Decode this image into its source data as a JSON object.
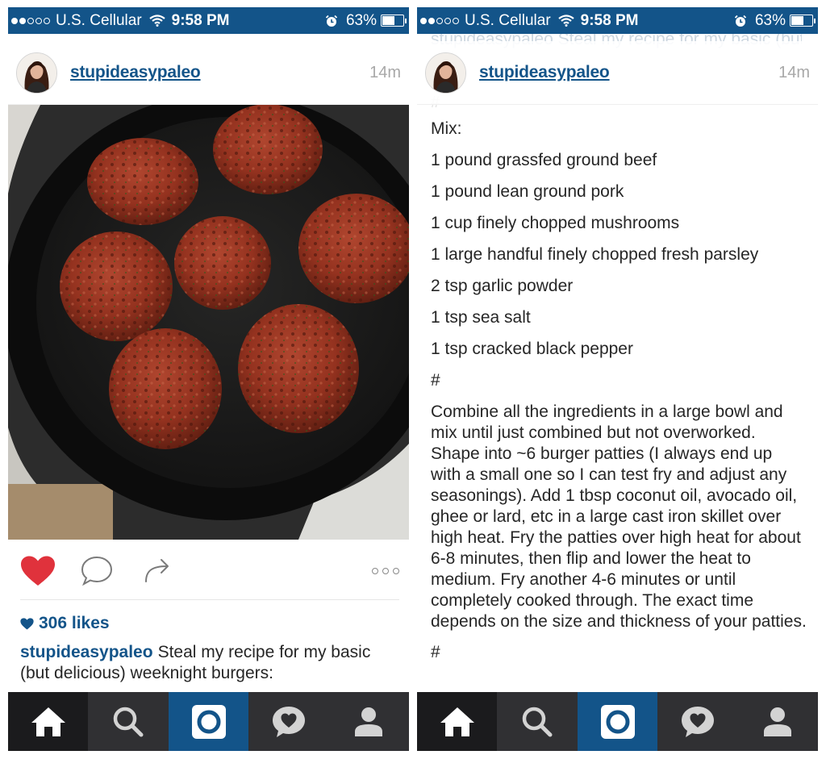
{
  "status_bar": {
    "carrier": "U.S. Cellular",
    "time": "9:58 PM",
    "battery": "63%",
    "battery_level": 0.63
  },
  "post": {
    "username": "stupideasypaleo",
    "age": "14m",
    "likes": "306 likes",
    "caption": "Steal my recipe for my basic (but delicious) weeknight burgers:"
  },
  "recipe_screen": {
    "ghost_caption": "stupideasypaleo Steal my recipe for my basic (but delicious) weeknight burgers:",
    "ghost_hash": "#",
    "mix_heading": "Mix:",
    "ingredients": [
      "1 pound grassfed ground beef",
      "1 pound lean ground pork",
      "1 cup finely chopped mushrooms",
      "1 large handful finely chopped fresh parsley",
      "2 tsp garlic powder",
      "1 tsp sea salt",
      "1 tsp cracked black pepper"
    ],
    "separator": "#",
    "instructions": "Combine all the ingredients in a large bowl and mix until just combined but not overworked. Shape into ~6 burger patties (I always end up with a small one so I can test fry and adjust any seasonings). Add 1 tbsp coconut oil, avocado oil, ghee or lard, etc in a large cast iron skillet over high heat. Fry the patties over high heat for about 6-8 minutes, then flip and lower the heat to medium. Fry another 4-6 minutes or until completely cooked through. The exact time depends on the size and thickness of your patties.",
    "tail_separator": "#"
  },
  "tab_bar": {
    "tabs": [
      "home-icon",
      "search-icon",
      "camera-icon",
      "activity-icon",
      "profile-icon"
    ]
  },
  "colors": {
    "accent": "#135489",
    "like_red": "#e0323c",
    "tab_bar": "#303033"
  }
}
